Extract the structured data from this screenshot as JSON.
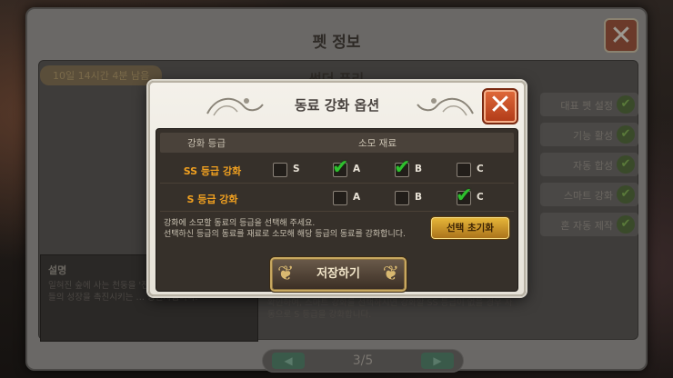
{
  "background": {
    "title": "펫 정보",
    "subtitle": "썬더 퓨리",
    "time_badge": "10일 14시간 4분 남음",
    "description_title": "설명",
    "description_text": "일혀진 숲에 사는 천둥을 '전설 퓨리'의 새끼입니다. 동료들의 성장을 촉진시키는 … 동반자입니다.",
    "description_right": "확인하여, 스마트 강화를 선택하시면 강화할 SS 등급이 없을 경우 자동으로 S 등급을 강화합니다.",
    "right_items": [
      {
        "label": "대표 펫 설정"
      },
      {
        "label": "기능 활성"
      },
      {
        "label": "자동 합성"
      },
      {
        "label": "스마트 강화"
      },
      {
        "label": "혼 자동 제작"
      }
    ],
    "pager": "3/5"
  },
  "modal": {
    "title": "동료 강화 옵션",
    "headers": {
      "grade": "강화 등급",
      "material": "소모 재료"
    },
    "rows": [
      {
        "label": "SS 등급 강화",
        "options": [
          {
            "label": "S",
            "checked": false
          },
          {
            "label": "A",
            "checked": true
          },
          {
            "label": "B",
            "checked": true
          },
          {
            "label": "C",
            "checked": false
          }
        ]
      },
      {
        "label": "S 등급 강화",
        "options": [
          {
            "label": "A",
            "checked": false
          },
          {
            "label": "B",
            "checked": false
          },
          {
            "label": "C",
            "checked": true
          }
        ]
      }
    ],
    "info_line1": "강화에 소모할 동료의 등급을 선택해 주세요.",
    "info_line2": "선택하신 등급의 동료를 재료로 소모해 해당 등급의 동료를 강화합니다.",
    "reset_label": "선택 초기화",
    "save_label": "저장하기"
  }
}
